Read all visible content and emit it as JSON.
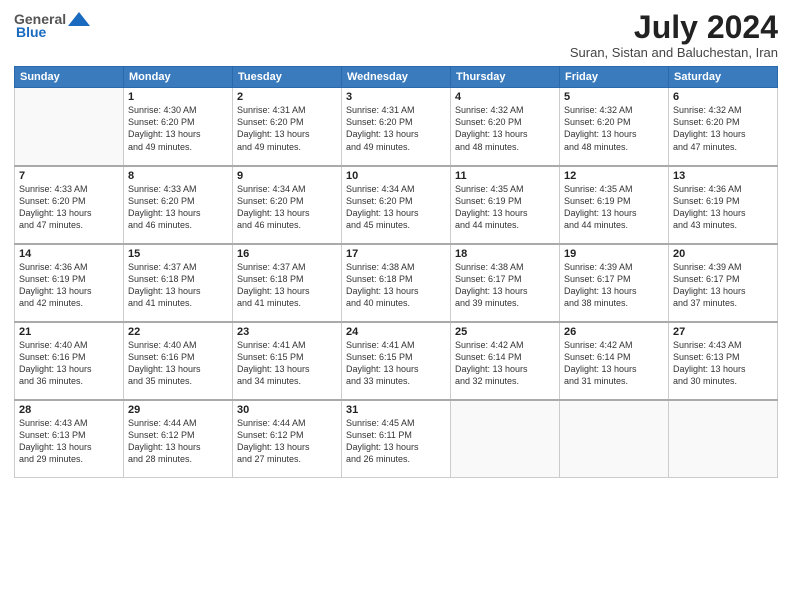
{
  "header": {
    "logo_general": "General",
    "logo_blue": "Blue",
    "month_year": "July 2024",
    "location": "Suran, Sistan and Baluchestan, Iran"
  },
  "weekdays": [
    "Sunday",
    "Monday",
    "Tuesday",
    "Wednesday",
    "Thursday",
    "Friday",
    "Saturday"
  ],
  "weeks": [
    [
      {
        "day": "",
        "info": ""
      },
      {
        "day": "1",
        "info": "Sunrise: 4:30 AM\nSunset: 6:20 PM\nDaylight: 13 hours\nand 49 minutes."
      },
      {
        "day": "2",
        "info": "Sunrise: 4:31 AM\nSunset: 6:20 PM\nDaylight: 13 hours\nand 49 minutes."
      },
      {
        "day": "3",
        "info": "Sunrise: 4:31 AM\nSunset: 6:20 PM\nDaylight: 13 hours\nand 49 minutes."
      },
      {
        "day": "4",
        "info": "Sunrise: 4:32 AM\nSunset: 6:20 PM\nDaylight: 13 hours\nand 48 minutes."
      },
      {
        "day": "5",
        "info": "Sunrise: 4:32 AM\nSunset: 6:20 PM\nDaylight: 13 hours\nand 48 minutes."
      },
      {
        "day": "6",
        "info": "Sunrise: 4:32 AM\nSunset: 6:20 PM\nDaylight: 13 hours\nand 47 minutes."
      }
    ],
    [
      {
        "day": "7",
        "info": "Sunrise: 4:33 AM\nSunset: 6:20 PM\nDaylight: 13 hours\nand 47 minutes."
      },
      {
        "day": "8",
        "info": "Sunrise: 4:33 AM\nSunset: 6:20 PM\nDaylight: 13 hours\nand 46 minutes."
      },
      {
        "day": "9",
        "info": "Sunrise: 4:34 AM\nSunset: 6:20 PM\nDaylight: 13 hours\nand 46 minutes."
      },
      {
        "day": "10",
        "info": "Sunrise: 4:34 AM\nSunset: 6:20 PM\nDaylight: 13 hours\nand 45 minutes."
      },
      {
        "day": "11",
        "info": "Sunrise: 4:35 AM\nSunset: 6:19 PM\nDaylight: 13 hours\nand 44 minutes."
      },
      {
        "day": "12",
        "info": "Sunrise: 4:35 AM\nSunset: 6:19 PM\nDaylight: 13 hours\nand 44 minutes."
      },
      {
        "day": "13",
        "info": "Sunrise: 4:36 AM\nSunset: 6:19 PM\nDaylight: 13 hours\nand 43 minutes."
      }
    ],
    [
      {
        "day": "14",
        "info": "Sunrise: 4:36 AM\nSunset: 6:19 PM\nDaylight: 13 hours\nand 42 minutes."
      },
      {
        "day": "15",
        "info": "Sunrise: 4:37 AM\nSunset: 6:18 PM\nDaylight: 13 hours\nand 41 minutes."
      },
      {
        "day": "16",
        "info": "Sunrise: 4:37 AM\nSunset: 6:18 PM\nDaylight: 13 hours\nand 41 minutes."
      },
      {
        "day": "17",
        "info": "Sunrise: 4:38 AM\nSunset: 6:18 PM\nDaylight: 13 hours\nand 40 minutes."
      },
      {
        "day": "18",
        "info": "Sunrise: 4:38 AM\nSunset: 6:17 PM\nDaylight: 13 hours\nand 39 minutes."
      },
      {
        "day": "19",
        "info": "Sunrise: 4:39 AM\nSunset: 6:17 PM\nDaylight: 13 hours\nand 38 minutes."
      },
      {
        "day": "20",
        "info": "Sunrise: 4:39 AM\nSunset: 6:17 PM\nDaylight: 13 hours\nand 37 minutes."
      }
    ],
    [
      {
        "day": "21",
        "info": "Sunrise: 4:40 AM\nSunset: 6:16 PM\nDaylight: 13 hours\nand 36 minutes."
      },
      {
        "day": "22",
        "info": "Sunrise: 4:40 AM\nSunset: 6:16 PM\nDaylight: 13 hours\nand 35 minutes."
      },
      {
        "day": "23",
        "info": "Sunrise: 4:41 AM\nSunset: 6:15 PM\nDaylight: 13 hours\nand 34 minutes."
      },
      {
        "day": "24",
        "info": "Sunrise: 4:41 AM\nSunset: 6:15 PM\nDaylight: 13 hours\nand 33 minutes."
      },
      {
        "day": "25",
        "info": "Sunrise: 4:42 AM\nSunset: 6:14 PM\nDaylight: 13 hours\nand 32 minutes."
      },
      {
        "day": "26",
        "info": "Sunrise: 4:42 AM\nSunset: 6:14 PM\nDaylight: 13 hours\nand 31 minutes."
      },
      {
        "day": "27",
        "info": "Sunrise: 4:43 AM\nSunset: 6:13 PM\nDaylight: 13 hours\nand 30 minutes."
      }
    ],
    [
      {
        "day": "28",
        "info": "Sunrise: 4:43 AM\nSunset: 6:13 PM\nDaylight: 13 hours\nand 29 minutes."
      },
      {
        "day": "29",
        "info": "Sunrise: 4:44 AM\nSunset: 6:12 PM\nDaylight: 13 hours\nand 28 minutes."
      },
      {
        "day": "30",
        "info": "Sunrise: 4:44 AM\nSunset: 6:12 PM\nDaylight: 13 hours\nand 27 minutes."
      },
      {
        "day": "31",
        "info": "Sunrise: 4:45 AM\nSunset: 6:11 PM\nDaylight: 13 hours\nand 26 minutes."
      },
      {
        "day": "",
        "info": ""
      },
      {
        "day": "",
        "info": ""
      },
      {
        "day": "",
        "info": ""
      }
    ]
  ]
}
